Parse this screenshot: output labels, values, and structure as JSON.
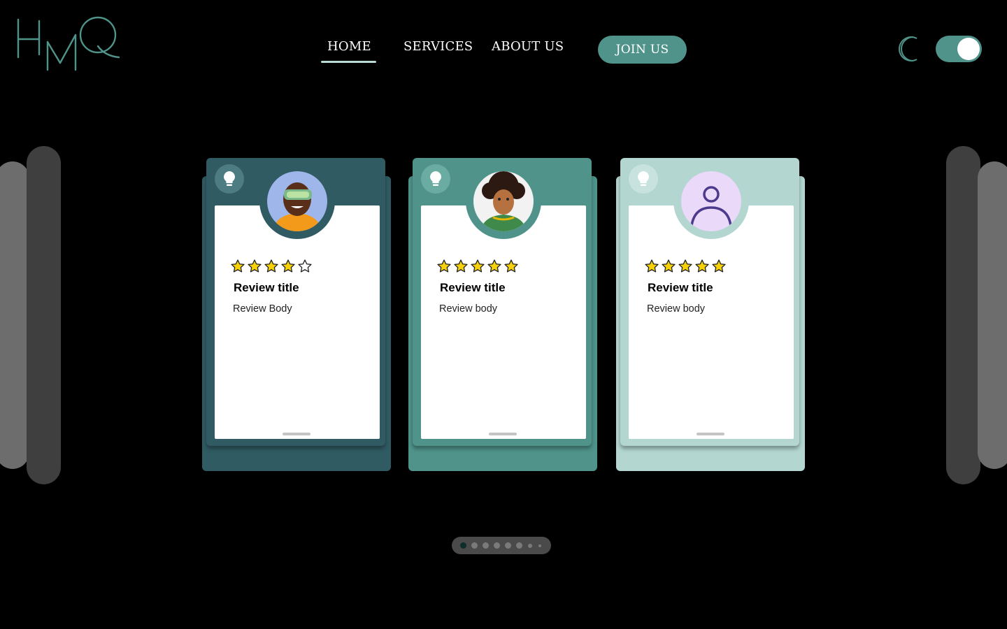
{
  "brand": {
    "logo_text": "HMQ",
    "accent": "#4f938a"
  },
  "nav": {
    "home": "HOME",
    "services": "SERVICES",
    "about": "ABOUT US",
    "join": "JOIN US",
    "active": "HOME"
  },
  "theme_toggle": {
    "icon": "moon-icon",
    "on": true
  },
  "cards": [
    {
      "color_back": "#305b63",
      "color_front": "#305b63",
      "bulb_bg": "#4d7c83",
      "ring": "#305b63",
      "avatar": "vr-headset-avatar",
      "rating": 4,
      "max_rating": 5,
      "title": "Review title",
      "body": "Review Body"
    },
    {
      "color_back": "#4f938a",
      "color_front": "#4f938a",
      "bulb_bg": "#6aaba2",
      "ring": "#4f938a",
      "avatar": "curly-hair-avatar",
      "rating": 5,
      "max_rating": 5,
      "title": "Review title",
      "body": "Review body"
    },
    {
      "color_back": "#b3d6d0",
      "color_front": "#b3d6d0",
      "bulb_bg": "#c8e3de",
      "ring": "#b3d6d0",
      "avatar": "generic-user-icon",
      "rating": 5,
      "max_rating": 5,
      "title": "Review title",
      "body": "Review body"
    }
  ],
  "pager": {
    "count": 8,
    "active": 0
  }
}
